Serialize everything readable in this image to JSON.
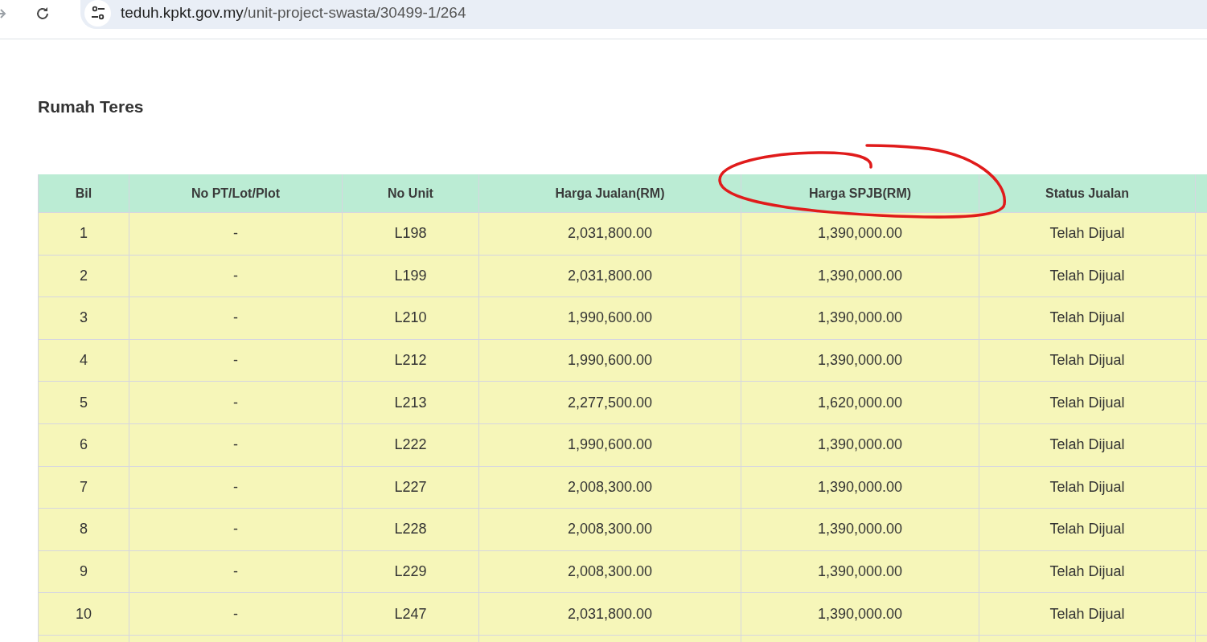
{
  "browser": {
    "url_host": "teduh.kpkt.gov.my",
    "url_path": "/unit-project-swasta/30499-1/264"
  },
  "section_title": "Rumah Teres",
  "table": {
    "columns": [
      "Bil",
      "No PT/Lot/Plot",
      "No Unit",
      "Harga Jualan(RM)",
      "Harga SPJB(RM)",
      "Status Jualan"
    ],
    "rows": [
      [
        "1",
        "-",
        "L198",
        "2,031,800.00",
        "1,390,000.00",
        "Telah Dijual"
      ],
      [
        "2",
        "-",
        "L199",
        "2,031,800.00",
        "1,390,000.00",
        "Telah Dijual"
      ],
      [
        "3",
        "-",
        "L210",
        "1,990,600.00",
        "1,390,000.00",
        "Telah Dijual"
      ],
      [
        "4",
        "-",
        "L212",
        "1,990,600.00",
        "1,390,000.00",
        "Telah Dijual"
      ],
      [
        "5",
        "-",
        "L213",
        "2,277,500.00",
        "1,620,000.00",
        "Telah Dijual"
      ],
      [
        "6",
        "-",
        "L222",
        "1,990,600.00",
        "1,390,000.00",
        "Telah Dijual"
      ],
      [
        "7",
        "-",
        "L227",
        "2,008,300.00",
        "1,390,000.00",
        "Telah Dijual"
      ],
      [
        "8",
        "-",
        "L228",
        "2,008,300.00",
        "1,390,000.00",
        "Telah Dijual"
      ],
      [
        "9",
        "-",
        "L229",
        "2,008,300.00",
        "1,390,000.00",
        "Telah Dijual"
      ],
      [
        "10",
        "-",
        "L247",
        "2,031,800.00",
        "1,390,000.00",
        "Telah Dijual"
      ]
    ]
  }
}
